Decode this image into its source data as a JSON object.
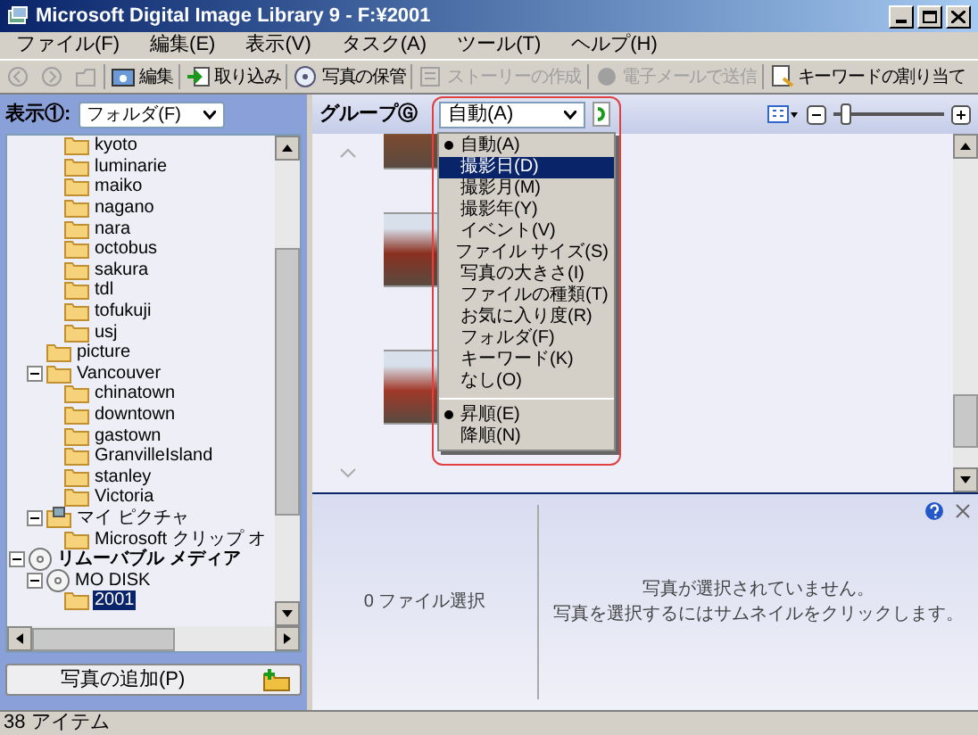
{
  "window": {
    "title": "Microsoft Digital Image Library 9 - F:¥2001"
  },
  "menu_bar": [
    "ファイル(F)",
    "編集(E)",
    "表示(V)",
    "タスク(A)",
    "ツール(T)",
    "ヘルプ(H)"
  ],
  "toolbar": [
    {
      "kind": "back",
      "disabled": true
    },
    {
      "kind": "forward",
      "disabled": true
    },
    {
      "kind": "up",
      "disabled": true
    },
    {
      "kind": "edit",
      "label": "編集",
      "disabled": false
    },
    {
      "kind": "import",
      "label": "取り込み",
      "disabled": false
    },
    {
      "kind": "archive",
      "label": "写真の保管",
      "disabled": false
    },
    {
      "kind": "story",
      "label": "ストーリーの作成",
      "disabled": true
    },
    {
      "kind": "mail",
      "label": "電子メールで送信",
      "disabled": true
    },
    {
      "kind": "keyword",
      "label": "キーワードの割り当て",
      "disabled": false
    }
  ],
  "view_selector": {
    "label": "表示①:",
    "value": "フォルダ(F)"
  },
  "tree": [
    {
      "children": [
        {
          "children": [
            {
              "label": "kyoto",
              "kind": "folder",
              "selected": false
            },
            {
              "label": "luminarie",
              "kind": "folder",
              "selected": false
            },
            {
              "label": "maiko",
              "kind": "folder",
              "selected": false
            },
            {
              "label": "nagano",
              "kind": "folder",
              "selected": false
            },
            {
              "label": "nara",
              "kind": "folder",
              "selected": false
            },
            {
              "label": "octobus",
              "kind": "folder",
              "selected": false
            },
            {
              "label": "sakura",
              "kind": "folder",
              "selected": false
            },
            {
              "label": "tdl",
              "kind": "folder",
              "selected": false
            },
            {
              "label": "tofukuji",
              "kind": "folder",
              "selected": false
            },
            {
              "label": "usj",
              "kind": "folder",
              "selected": false
            }
          ]
        },
        {
          "label": "picture",
          "kind": "folder",
          "selected": false
        },
        {
          "label": "Vancouver",
          "kind": "folder",
          "selected": false,
          "expanded": true,
          "children": [
            {
              "label": "chinatown",
              "kind": "folder",
              "selected": false
            },
            {
              "label": "downtown",
              "kind": "folder",
              "selected": false
            },
            {
              "label": "gastown",
              "kind": "folder",
              "selected": false
            },
            {
              "label": "GranvilleIsland",
              "kind": "folder",
              "selected": false
            },
            {
              "label": "stanley",
              "kind": "folder",
              "selected": false
            },
            {
              "label": "Victoria",
              "kind": "folder",
              "selected": false
            }
          ]
        },
        {
          "label": "マイ ピクチャ",
          "kind": "pictures",
          "selected": false,
          "expanded": true,
          "children": [
            {
              "label": "Microsoft クリップ オ",
              "kind": "folder",
              "selected": false
            }
          ]
        }
      ]
    },
    {
      "label": "リムーバブル メディア",
      "kind": "disc",
      "bold": true,
      "selected": false,
      "expanded": true,
      "children": [
        {
          "label": "MO DISK",
          "kind": "disc",
          "selected": false,
          "expanded": true,
          "children": [
            {
              "label": "2001",
              "kind": "folder",
              "selected": true
            }
          ]
        }
      ]
    }
  ],
  "add_photos_button": "写真の追加(P)",
  "group_bar": {
    "label": "グループⒼ",
    "value": "自動(A)"
  },
  "group_menu": [
    [
      {
        "label": "自動(A)",
        "checked": true,
        "selected": false
      },
      {
        "label": "撮影日(D)",
        "checked": false,
        "selected": true
      },
      {
        "label": "撮影月(M)",
        "checked": false,
        "selected": false
      },
      {
        "label": "撮影年(Y)",
        "checked": false,
        "selected": false
      },
      {
        "label": "イベント(V)",
        "checked": false,
        "selected": false
      },
      {
        "label": "ファイル サイズ(S)",
        "checked": false,
        "selected": false
      },
      {
        "label": "写真の大きさ(I)",
        "checked": false,
        "selected": false
      },
      {
        "label": "ファイルの種類(T)",
        "checked": false,
        "selected": false
      },
      {
        "label": "お気に入り度(R)",
        "checked": false,
        "selected": false
      },
      {
        "label": "フォルダ(F)",
        "checked": false,
        "selected": false
      },
      {
        "label": "キーワード(K)",
        "checked": false,
        "selected": false
      },
      {
        "label": "なし(O)",
        "checked": false,
        "selected": false
      }
    ],
    [
      {
        "label": "昇順(E)",
        "checked": true,
        "selected": false
      },
      {
        "label": "降順(N)",
        "checked": false,
        "selected": false
      }
    ]
  ],
  "zoom_slider": {
    "level": 0.08
  },
  "details": {
    "selection_count": "0 ファイル選択",
    "message": [
      "写真が選択されていません。",
      "写真を選択するにはサムネイルをクリックします。"
    ]
  },
  "status_bar": "38 アイテム"
}
